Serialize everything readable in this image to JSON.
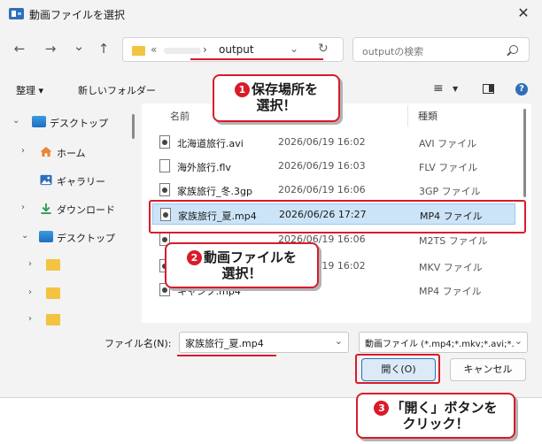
{
  "window": {
    "title": "動画ファイルを選択",
    "close_glyph": "✕"
  },
  "navigation": {
    "back_glyph": "←",
    "forward_glyph": "→",
    "recent_glyph": "⌄",
    "up_glyph": "↑"
  },
  "address_bar": {
    "prefix": "«",
    "separator": "›",
    "current_folder": "output",
    "dropdown_glyph": "⌄",
    "refresh_glyph": "↻"
  },
  "search": {
    "placeholder": "outputの検索"
  },
  "command_bar": {
    "organize": "整理 ▾",
    "new_folder": "新しいフォルダー",
    "view_glyph": "≡",
    "view_drop_glyph": "▼",
    "help_glyph": "?"
  },
  "sidebar": {
    "items": [
      {
        "label": "デスクトップ",
        "chevron": "⌄",
        "icon": "desktop-icon"
      },
      {
        "label": "ホーム",
        "chevron": "›",
        "icon": "home-icon"
      },
      {
        "label": "ギャラリー",
        "chevron": "",
        "icon": "gallery-icon"
      },
      {
        "label": "ダウンロード",
        "chevron": "›",
        "icon": "download-icon"
      },
      {
        "label": "デスクトップ",
        "chevron": "⌄",
        "icon": "desktop-icon"
      },
      {
        "label": "",
        "chevron": "›",
        "icon": "folder-icon"
      },
      {
        "label": "",
        "chevron": "›",
        "icon": "folder-icon"
      },
      {
        "label": "",
        "chevron": "›",
        "icon": "folder-icon"
      }
    ]
  },
  "file_list": {
    "columns": {
      "name": "名前",
      "date": "",
      "type": "種類"
    },
    "sort_glyph": "⌃",
    "rows": [
      {
        "name": "北海道旅行.avi",
        "date": "2026/06/19 16:02",
        "type": "AVI ファイル",
        "icon": "video-file-icon"
      },
      {
        "name": "海外旅行.flv",
        "date": "2026/06/19 16:03",
        "type": "FLV ファイル",
        "icon": "file-icon"
      },
      {
        "name": "家族旅行_冬.3gp",
        "date": "2026/06/19 16:06",
        "type": "3GP ファイル",
        "icon": "video-file-icon"
      },
      {
        "name": "家族旅行_夏.mp4",
        "date": "2026/06/26 17:27",
        "type": "MP4 ファイル",
        "icon": "video-file-icon",
        "selected": true
      },
      {
        "name": "",
        "date": "2026/06/19 16:06",
        "type": "M2TS ファイル",
        "icon": "video-file-icon"
      },
      {
        "name": "",
        "date": "2026/06/19 16:02",
        "type": "MKV ファイル",
        "icon": "video-file-icon"
      },
      {
        "name": "キャンプ.mp4",
        "date": "",
        "type": "MP4 ファイル",
        "icon": "video-file-icon"
      }
    ]
  },
  "footer": {
    "filename_label": "ファイル名(N):",
    "filename_value": "家族旅行_夏.mp4",
    "filetype_value": "動画ファイル (*.mp4;*.mkv;*.avi;*.",
    "dropdown_glyph": "⌄",
    "open_button": "開く(O)",
    "cancel_button": "キャンセル"
  },
  "callouts": [
    {
      "number": "1",
      "lines": [
        "保存場所を",
        "選択！"
      ]
    },
    {
      "number": "2",
      "lines": [
        "動画ファイルを",
        "選択！"
      ]
    },
    {
      "number": "3",
      "lines": [
        "「開く」ボタンを",
        "クリック！"
      ]
    }
  ],
  "colors": {
    "accent": "#2f6fb8",
    "callout_red": "#d81c2a",
    "selection": "#cce4f7"
  }
}
